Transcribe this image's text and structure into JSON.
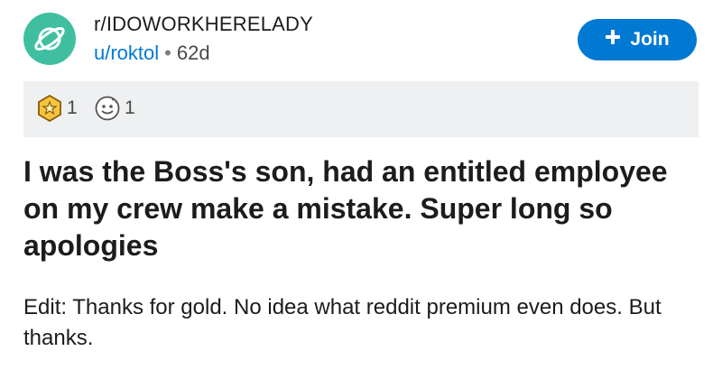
{
  "post": {
    "subreddit": "r/IDOWORKHERELADY",
    "author": "u/roktol",
    "age": "62d",
    "join_label": "Join",
    "awards": [
      {
        "icon": "gold-award-icon",
        "count": "1"
      },
      {
        "icon": "wholesome-award-icon",
        "count": "1"
      }
    ],
    "title": "I was the Boss's son, had an entitled employee on my crew make a mistake. Super long so apologies",
    "body": "Edit: Thanks for gold. No idea what reddit premium even does. But thanks."
  },
  "colors": {
    "accent": "#0079d3",
    "avatar": "#3fbf9f",
    "award_bar": "#eff0f1",
    "text": "#1c1c1c"
  }
}
